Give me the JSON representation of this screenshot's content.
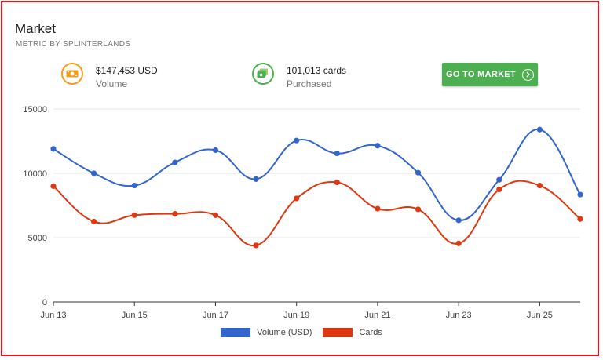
{
  "header": {
    "title": "Market",
    "subtitle": "METRIC BY SPLINTERLANDS"
  },
  "stats": {
    "volume": {
      "value": "$147,453 USD",
      "label": "Volume",
      "icon": "money-icon",
      "color": "#f59c1a"
    },
    "cards": {
      "value": "101,013 cards",
      "label": "Purchased",
      "icon": "cards-icon",
      "color": "#4caf50"
    }
  },
  "button": {
    "label": "GO TO MARKET",
    "icon": "chevron-right-circle-icon",
    "color": "#4caf50"
  },
  "chart_data": {
    "type": "line",
    "categories": [
      "Jun 13",
      "Jun 14",
      "Jun 15",
      "Jun 16",
      "Jun 17",
      "Jun 18",
      "Jun 19",
      "Jun 20",
      "Jun 21",
      "Jun 22",
      "Jun 23",
      "Jun 24",
      "Jun 25",
      "Jun 26"
    ],
    "tick_labels": [
      "Jun 13",
      "Jun 15",
      "Jun 17",
      "Jun 19",
      "Jun 21",
      "Jun 23",
      "Jun 25"
    ],
    "y_ticks": [
      "15000",
      "10000",
      "5000",
      "0"
    ],
    "ylim": [
      0,
      15000
    ],
    "grid": true,
    "legend_placement": "bottom",
    "series": [
      {
        "name": "Volume (USD)",
        "color": "#3366cc",
        "values": [
          11900,
          10000,
          9050,
          10850,
          11800,
          9550,
          12550,
          11550,
          12150,
          10050,
          6350,
          9500,
          13400,
          8350
        ]
      },
      {
        "name": "Cards",
        "color": "#dc3912",
        "values": [
          9000,
          6250,
          6750,
          6850,
          6750,
          4400,
          8050,
          9300,
          7250,
          7200,
          4550,
          8750,
          9050,
          6450
        ]
      }
    ]
  }
}
